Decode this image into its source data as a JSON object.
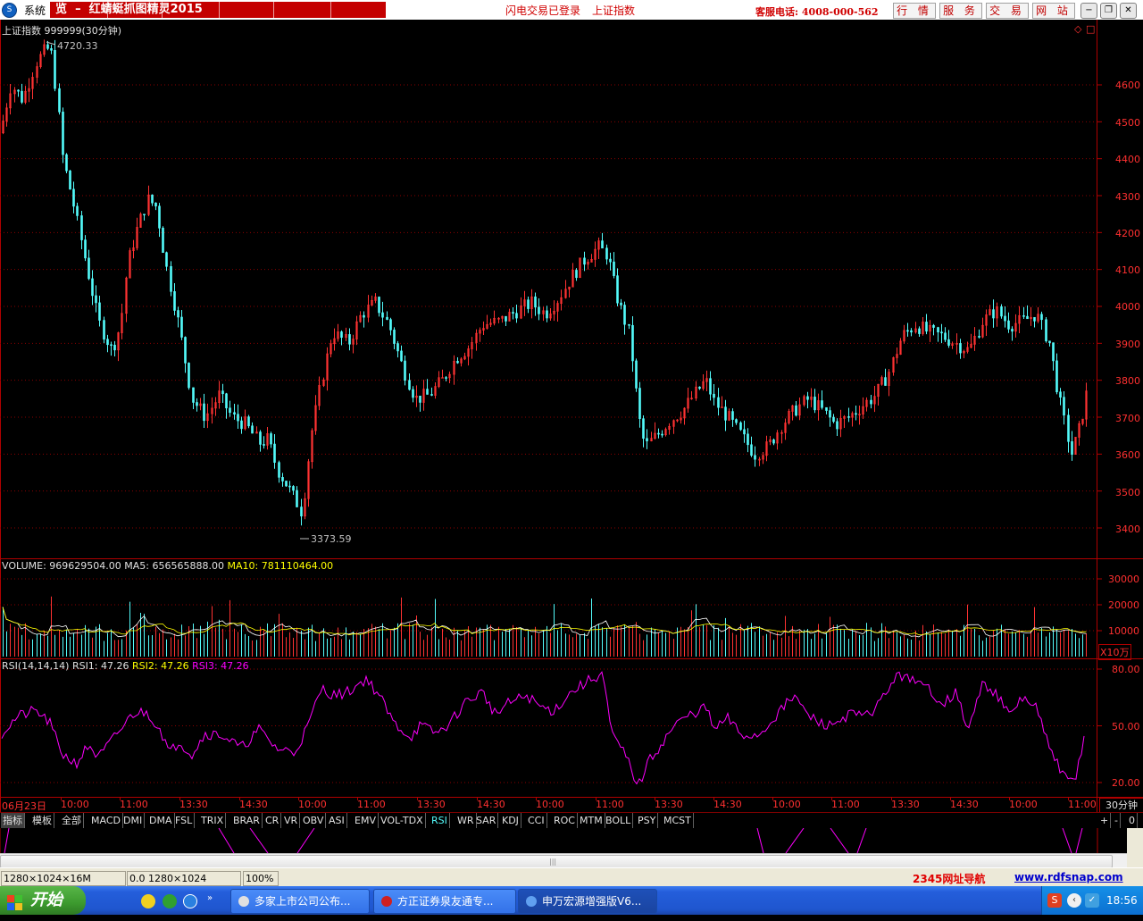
{
  "window": {
    "icon_glyph": "S",
    "system_menu": "系统",
    "title_prefix": "览",
    "title_dash": "–",
    "title_app": "红蜻蜓抓图精灵2015",
    "login_status": "闪电交易已登录",
    "current_index": "上证指数",
    "hotline": "客服电话: 4008-000-562",
    "nav_buttons": [
      "行 情",
      "服 务",
      "交 易",
      "网 站"
    ],
    "controls": [
      "−",
      "❐",
      "✕"
    ]
  },
  "main_chart": {
    "header": "上证指数 999999(30分钟)",
    "high_label": "4720.33",
    "low_label": "3373.59",
    "y_ticks": [
      "4600",
      "4500",
      "4400",
      "4300",
      "4200",
      "4100",
      "4000",
      "3900",
      "3800",
      "3700",
      "3600",
      "3500",
      "3400"
    ],
    "corner_icons": [
      "◇",
      "□"
    ]
  },
  "volume_panel": {
    "label": "VOLUME:",
    "value": "969629504.00",
    "ma5_label": "MA5:",
    "ma5_value": "656565888.00",
    "ma10_label": "MA10:",
    "ma10_value": "781110464.00",
    "y_ticks": [
      "30000",
      "20000",
      "10000"
    ],
    "unit": "X10万"
  },
  "rsi_panel": {
    "label": "RSI(14,14,14)",
    "rsi1_label": "RSI1:",
    "rsi1_value": "47.26",
    "rsi2_label": "RSI2:",
    "rsi2_value": "47.26",
    "rsi3_label": "RSI3:",
    "rsi3_value": "47.26",
    "y_ticks": [
      "80.00",
      "50.00",
      "20.00"
    ]
  },
  "time_axis": {
    "labels": [
      "06月23日",
      "10:00",
      "11:00",
      "13:30",
      "14:30",
      "10:00",
      "11:00",
      "13:30",
      "14:30",
      "10:00",
      "11:00",
      "13:30",
      "14:30",
      "10:00",
      "11:00",
      "13:30",
      "14:30",
      "10:00",
      "11:00"
    ],
    "period": "30分钟"
  },
  "indicator_tabs": [
    "指标",
    "模板",
    "全部",
    "MACD",
    "DMI",
    "DMA",
    "FSL",
    "TRIX",
    "BRAR",
    "CR",
    "VR",
    "OBV",
    "ASI",
    "EMV",
    "VOL-TDX",
    "RSI",
    "WR",
    "SAR",
    "KDJ",
    "CCI",
    "ROC",
    "MTM",
    "BOLL",
    "PSY",
    "MCST"
  ],
  "active_tab": "RSI",
  "tab_controls": [
    "+",
    "-",
    "0"
  ],
  "status_bar": {
    "size_info": "1280×1024×16M",
    "coord_info": "0.0 1280×1024",
    "zoom": "100%",
    "nav_link": "2345网址导航",
    "site_link": "www.rdfsnap.com"
  },
  "taskbar": {
    "start_label": "开始",
    "items": [
      "多家上市公司公布...",
      "方正证券泉友通专...",
      "申万宏源增强版V6..."
    ],
    "clock": "18:56",
    "quicklaunch_icons": [
      "qq-icon",
      "media-icon",
      "ie-icon"
    ]
  },
  "colors": {
    "up": "#ff3232",
    "down": "#54fcfc",
    "axis": "#b00000",
    "ma5": "#ffffff",
    "ma10": "#ffff00",
    "rsi": "#ff00ff"
  }
}
